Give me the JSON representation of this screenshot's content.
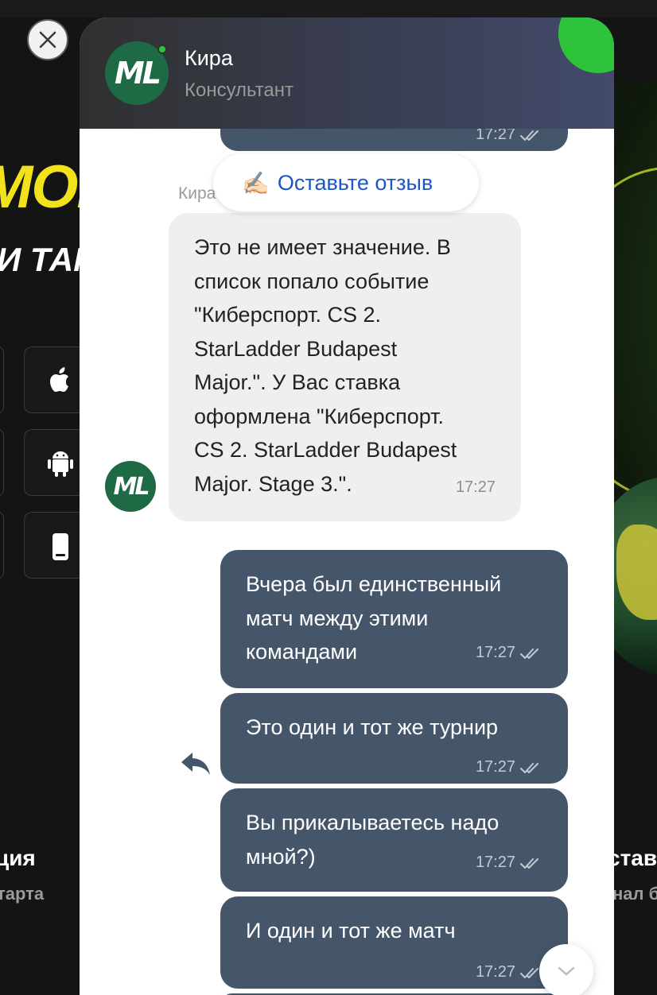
{
  "background": {
    "promo_title": "МОБИ",
    "promo_subtitle": "И ТАМ",
    "store_icons": [
      "apple-icon",
      "android-icon",
      "phone-icon"
    ],
    "feature_left": {
      "title": "ция",
      "subtitle": "тарта"
    },
    "feature_right": {
      "title": "став",
      "subtitle": "нал б"
    }
  },
  "chat": {
    "header": {
      "avatar_text": "ML",
      "agent_name": "Кира",
      "agent_role": "Консультант"
    },
    "feedback_button": {
      "emoji": "✍🏻",
      "label": "Оставьте отзыв"
    },
    "messages": [
      {
        "direction": "out",
        "text": "",
        "time": "17:27",
        "status": "read"
      },
      {
        "direction": "in",
        "sender": "Кира",
        "avatar_text": "ML",
        "lines": [
          "Это не имеет значение. В",
          "список попало событие",
          "\"Киберспорт. CS 2.",
          "StarLadder Budapest",
          "Major.\". У Вас ставка",
          "оформлена \"Киберспорт.",
          "CS 2. StarLadder Budapest",
          "Major. Stage 3.\"."
        ],
        "time": "17:27"
      },
      {
        "direction": "out",
        "lines": [
          "Вчера был единственный",
          "матч между этими",
          "командами"
        ],
        "time": "17:27",
        "status": "read"
      },
      {
        "direction": "out",
        "lines": [
          "Это один и тот же турнир"
        ],
        "time": "17:27",
        "status": "read"
      },
      {
        "direction": "out",
        "lines": [
          "Вы прикалываетесь надо",
          "мной?)"
        ],
        "time": "17:27",
        "status": "read"
      },
      {
        "direction": "out",
        "lines": [
          "И один и тот же матч"
        ],
        "time": "17:27",
        "status": "read"
      }
    ],
    "colors": {
      "outgoing_bubble": "#46566a",
      "incoming_bubble": "#f0eff0",
      "avatar": "#1d6a45",
      "online": "#2fc33b",
      "link": "#1e56c7"
    }
  }
}
